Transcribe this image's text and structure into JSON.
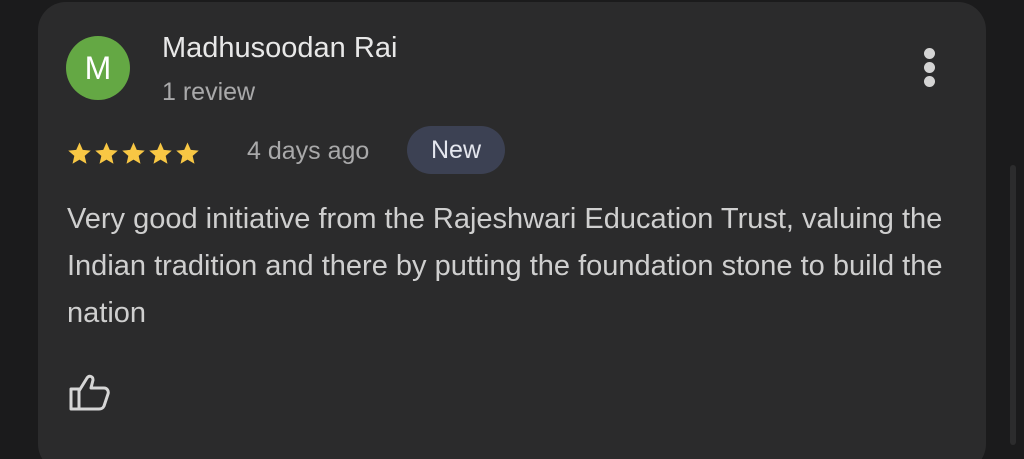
{
  "review": {
    "avatar_initial": "M",
    "author_name": "Madhusoodan Rai",
    "review_count": "1 review",
    "rating": 5,
    "rating_max": 5,
    "time_ago": "4 days ago",
    "badge": "New",
    "text": "Very good initiative from the Rajeshwari Education Trust, valuing the Indian tradition and there by putting the foundation stone to build the nation"
  },
  "icons": {
    "more": "more-vert-icon",
    "star": "star-icon",
    "like": "thumb-up-icon"
  },
  "colors": {
    "background": "#1b1b1c",
    "card": "#2b2b2c",
    "avatar": "#64a844",
    "star": "#f8c744",
    "badge_bg": "#3c4153"
  }
}
